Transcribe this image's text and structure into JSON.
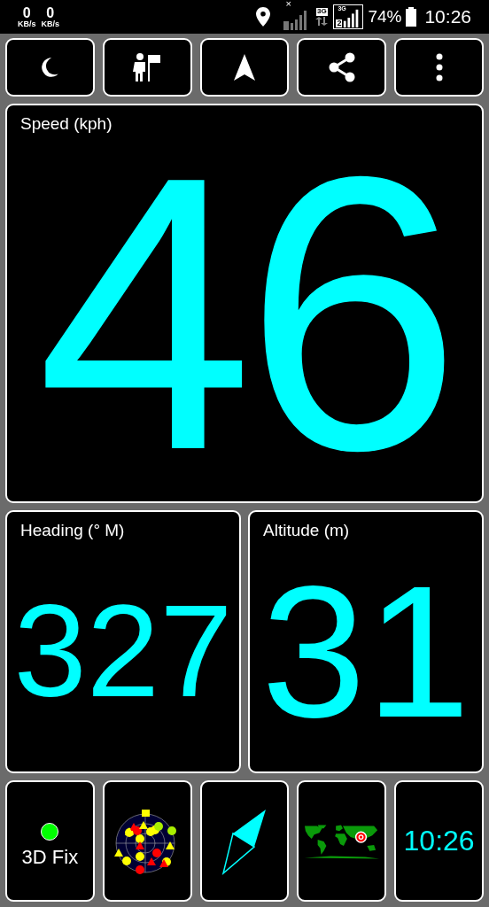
{
  "status_bar": {
    "net_speeds": [
      {
        "value": "0",
        "unit": "KB/s"
      },
      {
        "value": "0",
        "unit": "KB/s"
      }
    ],
    "sim1_mark": "×",
    "sim2_tech": "3G",
    "sim2_signal_tech": "3G",
    "sim2_slot": "2",
    "battery": "74%",
    "time": "10:26"
  },
  "toolbar": [
    {
      "kind": "night"
    },
    {
      "kind": "waypoint"
    },
    {
      "kind": "navigate"
    },
    {
      "kind": "share"
    },
    {
      "kind": "menu"
    }
  ],
  "speed": {
    "label": "Speed (kph)",
    "value": "46"
  },
  "heading": {
    "label": "Heading (° M)",
    "value": "327"
  },
  "altitude": {
    "label": "Altitude (m)",
    "value": "31"
  },
  "fix": {
    "label": "3D Fix",
    "color": "#00ff00"
  },
  "clock": "10:26"
}
